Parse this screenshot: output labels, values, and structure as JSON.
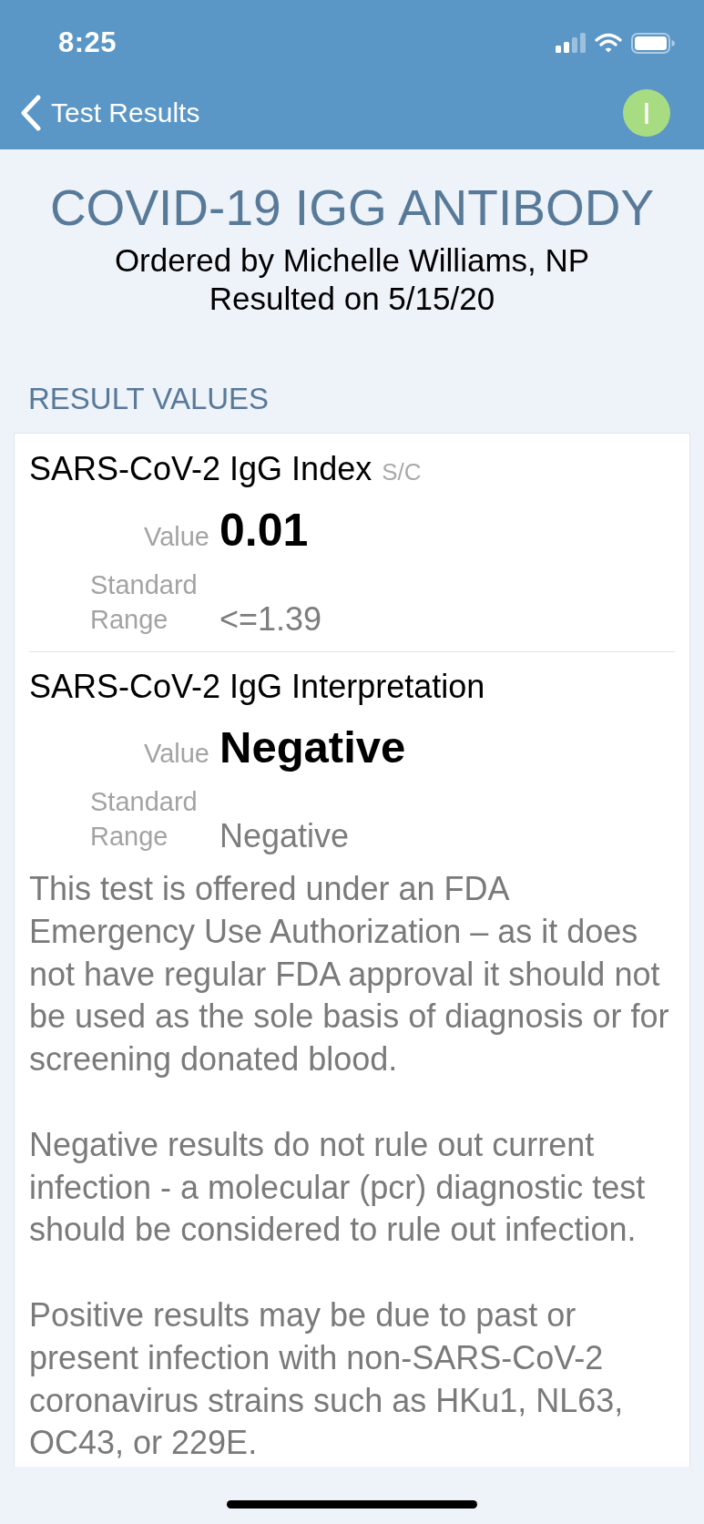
{
  "status_bar": {
    "time": "8:25"
  },
  "nav": {
    "back_label": "Test Results",
    "avatar_initial": "I"
  },
  "header": {
    "title": "COVID-19 IGG ANTIBODY",
    "ordered_by": "Ordered by Michelle Williams, NP",
    "resulted_on": "Resulted on 5/15/20"
  },
  "section_title": "RESULT VALUES",
  "results": [
    {
      "name": "SARS-CoV-2 IgG Index",
      "unit": "S/C",
      "value_label": "Value",
      "value": "0.01",
      "range_label": "Standard Range",
      "range": "<=1.39"
    },
    {
      "name": "SARS-CoV-2 IgG Interpretation",
      "value_label": "Value",
      "value": "Negative",
      "range_label": "Standard Range",
      "range": "Negative"
    }
  ],
  "comments": [
    "This test is offered under an FDA Emergency Use Authorization – as it does not have regular FDA approval it should not be used as the sole basis of diagnosis or for screening donated blood.",
    "Negative results do not rule out current infection - a molecular (pcr) diagnostic test should be considered to rule out infection.",
    "Positive results may be due to past or present infection with non-SARS-CoV-2 coronavirus strains such as HKu1, NL63, OC43, or 229E."
  ]
}
